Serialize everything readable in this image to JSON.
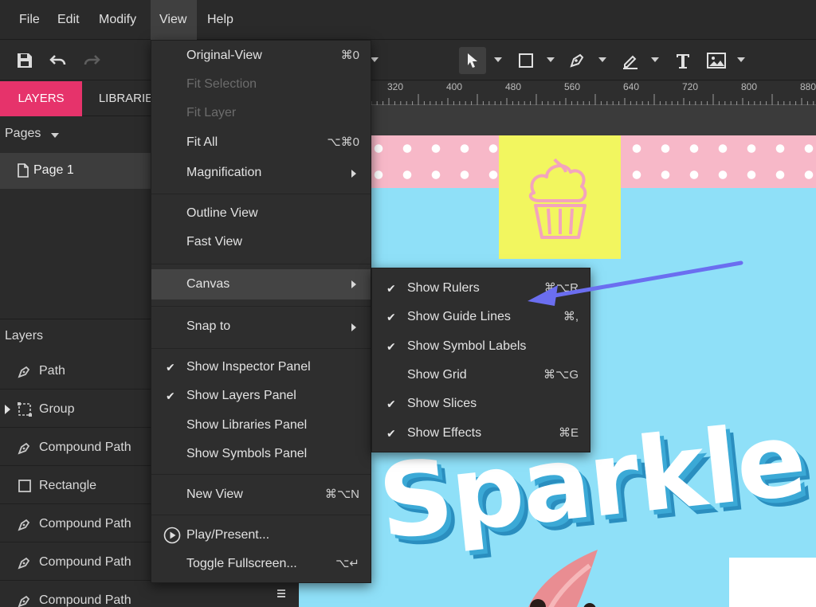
{
  "menubar": {
    "items": [
      {
        "label": "File"
      },
      {
        "label": "Edit"
      },
      {
        "label": "Modify"
      },
      {
        "label": "View"
      },
      {
        "label": "Help"
      }
    ]
  },
  "left_panel": {
    "tabs": [
      {
        "label": "LAYERS"
      },
      {
        "label": "LIBRARIE"
      }
    ],
    "pages_label": "Pages",
    "page_row": "Page 1",
    "layers_label": "Layers",
    "layers": [
      {
        "label": "Path",
        "icon": "pen-icon"
      },
      {
        "label": "Group",
        "icon": "group-icon"
      },
      {
        "label": "Compound Path",
        "icon": "pen-icon"
      },
      {
        "label": "Rectangle",
        "icon": "rectangle-icon"
      },
      {
        "label": "Compound Path",
        "icon": "pen-icon"
      },
      {
        "label": "Compound Path",
        "icon": "pen-icon"
      },
      {
        "label": "Compound Path",
        "icon": "pen-icon"
      }
    ]
  },
  "ruler": {
    "ticks": [
      "320",
      "400",
      "480",
      "560",
      "640",
      "720",
      "800",
      "880"
    ]
  },
  "artboard": {
    "title_text": "Sparkle"
  },
  "view_menu": {
    "items": [
      {
        "label": "Original-View",
        "shortcut": "⌘0"
      },
      {
        "label": "Fit Selection",
        "shortcut": ""
      },
      {
        "label": "Fit Layer",
        "shortcut": ""
      },
      {
        "label": "Fit All",
        "shortcut": "⌥⌘0"
      },
      {
        "label": "Magnification",
        "shortcut": ""
      },
      {
        "label": "Outline View",
        "shortcut": ""
      },
      {
        "label": "Fast View",
        "shortcut": ""
      },
      {
        "label": "Canvas",
        "shortcut": ""
      },
      {
        "label": "Snap to",
        "shortcut": ""
      },
      {
        "label": "Show Inspector Panel",
        "shortcut": ""
      },
      {
        "label": "Show Layers Panel",
        "shortcut": ""
      },
      {
        "label": "Show Libraries Panel",
        "shortcut": ""
      },
      {
        "label": "Show Symbols Panel",
        "shortcut": ""
      },
      {
        "label": "New View",
        "shortcut": "⌘⌥N"
      },
      {
        "label": "Play/Present...",
        "shortcut": ""
      },
      {
        "label": "Toggle Fullscreen...",
        "shortcut": "⌥↵"
      }
    ]
  },
  "canvas_submenu": {
    "items": [
      {
        "label": "Show Rulers",
        "shortcut": "⌘⌥R"
      },
      {
        "label": "Show Guide Lines",
        "shortcut": "⌘,"
      },
      {
        "label": "Show Symbol Labels",
        "shortcut": ""
      },
      {
        "label": "Show Grid",
        "shortcut": "⌘⌥G"
      },
      {
        "label": "Show Slices",
        "shortcut": ""
      },
      {
        "label": "Show Effects",
        "shortcut": "⌘E"
      }
    ]
  },
  "colors": {
    "accent": "#e6336b",
    "arrow": "#6b6ef0",
    "artboard_bg": "#8fe0f8"
  }
}
